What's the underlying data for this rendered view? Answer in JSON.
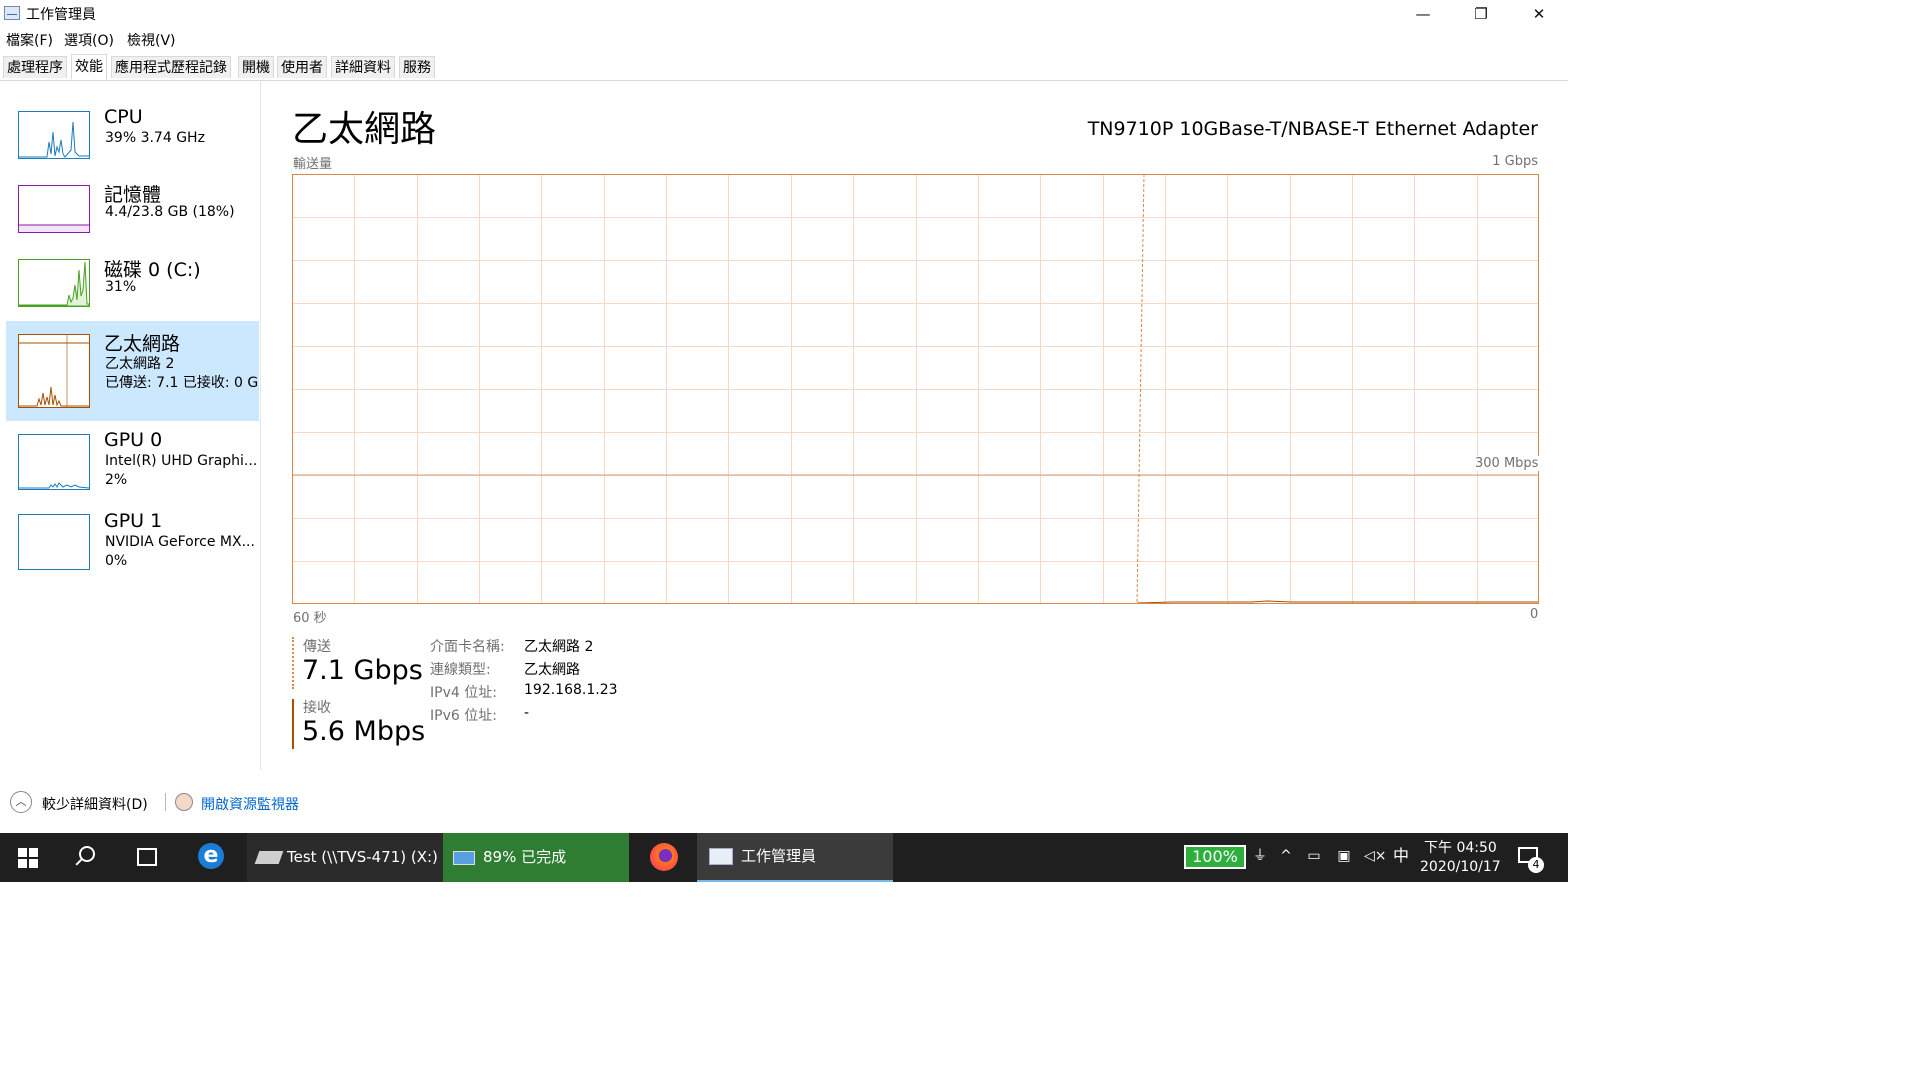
{
  "window": {
    "title": "工作管理員",
    "minimize_glyph": "—",
    "maximize_glyph": "❐",
    "close_glyph": "✕"
  },
  "menu": [
    "檔案(F)",
    "選項(O)",
    "檢視(V)"
  ],
  "tabs": [
    "處理程序",
    "效能",
    "應用程式歷程記錄",
    "開機",
    "使用者",
    "詳細資料",
    "服務"
  ],
  "active_tab": "效能",
  "sidebar": {
    "items": [
      {
        "title": "CPU",
        "lines": [
          "39%  3.74 GHz"
        ],
        "color": "#1a7bbf"
      },
      {
        "title": "記憶體",
        "lines": [
          "4.4/23.8 GB (18%)"
        ],
        "color": "#8b1aaa"
      },
      {
        "title": "磁碟 0 (C:)",
        "lines": [
          "31%"
        ],
        "color": "#4aa01f"
      },
      {
        "title": "乙太網路",
        "lines": [
          "乙太網路 2",
          "已傳送: 7.1  已接收: 0 G"
        ],
        "color": "#a74f01"
      },
      {
        "title": "GPU 0",
        "lines": [
          "Intel(R) UHD Graphi...",
          "2%"
        ],
        "color": "#1a7bbf"
      },
      {
        "title": "GPU 1",
        "lines": [
          "NVIDIA GeForce MX...",
          "0%"
        ],
        "color": "#1a7bbf"
      }
    ],
    "selected_index": 3
  },
  "main": {
    "title": "乙太網路",
    "adapter": "TN9710P 10GBase-T/NBASE-T Ethernet Adapter",
    "throughput_label": "輸送量",
    "max_label": "1 Gbps",
    "mid_label": "300 Mbps",
    "time_left": "60 秒",
    "time_right": "0",
    "graph_color": "#d9884a",
    "send_label": "傳送",
    "send_value": "7.1 Gbps",
    "recv_label": "接收",
    "recv_value": "5.6 Mbps",
    "properties": [
      {
        "label": "介面卡名稱:",
        "value": "乙太網路 2"
      },
      {
        "label": "連線類型:",
        "value": "乙太網路"
      },
      {
        "label": "IPv4 位址:",
        "value": "192.168.1.23"
      },
      {
        "label": "IPv6 位址:",
        "value": "-"
      }
    ]
  },
  "footer": {
    "fewer_details": "較少詳細資料(D)",
    "open_resmon": "開啟資源監視器"
  },
  "taskbar": {
    "test_drive": "Test (\\\\TVS-471) (X:)",
    "copy_progress": "89% 已完成",
    "taskmgr": "工作管理員",
    "battery": "100%",
    "ime": "中",
    "time": "下午 04:50",
    "date": "2020/10/17",
    "notifications": "4"
  }
}
